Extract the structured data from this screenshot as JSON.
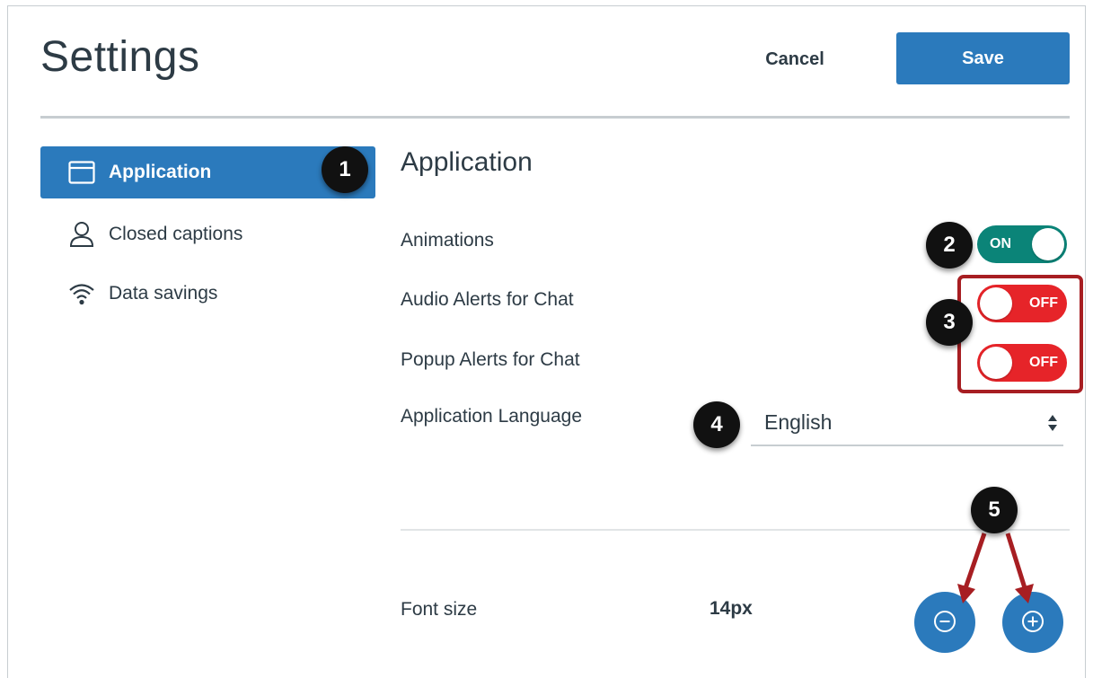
{
  "header": {
    "title": "Settings",
    "cancel_label": "Cancel",
    "save_label": "Save"
  },
  "sidebar": {
    "items": [
      {
        "label": "Application",
        "icon": "browser-window-icon",
        "active": true
      },
      {
        "label": "Closed captions",
        "icon": "person-icon",
        "active": false
      },
      {
        "label": "Data savings",
        "icon": "wifi-icon",
        "active": false
      }
    ]
  },
  "main": {
    "section_title": "Application",
    "settings": [
      {
        "label": "Animations",
        "toggle_text": "ON",
        "state": "on"
      },
      {
        "label": "Audio Alerts for Chat",
        "toggle_text": "OFF",
        "state": "off"
      },
      {
        "label": "Popup Alerts for Chat",
        "toggle_text": "OFF",
        "state": "off"
      }
    ],
    "language": {
      "label": "Application Language",
      "value": "English"
    },
    "font_size": {
      "label": "Font size",
      "value": "14px",
      "decrease_icon": "minus-circle-icon",
      "increase_icon": "plus-circle-icon"
    }
  },
  "callouts": [
    "1",
    "2",
    "3",
    "4",
    "5"
  ],
  "colors": {
    "primary": "#2b7abc",
    "toggle_on": "#0b8478",
    "toggle_off": "#e62429",
    "annotation_red": "#a71e22",
    "text": "#2d3b45"
  }
}
